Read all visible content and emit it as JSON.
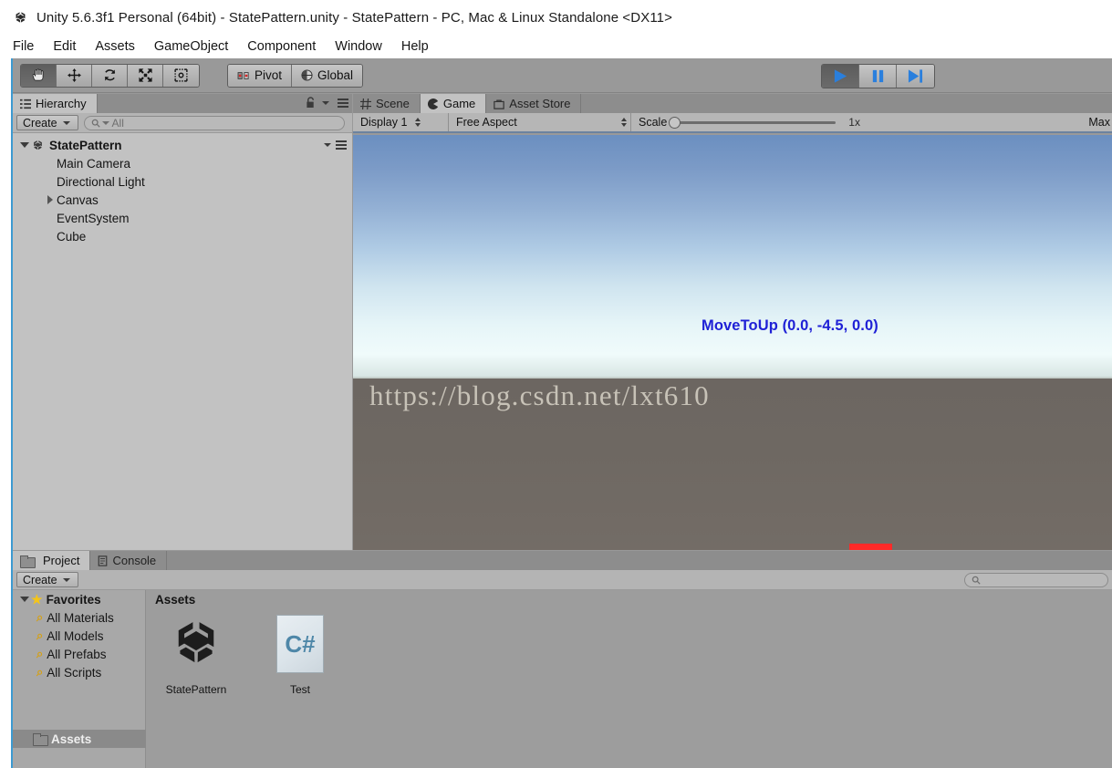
{
  "window": {
    "title": "Unity 5.6.3f1 Personal (64bit) - StatePattern.unity - StatePattern - PC, Mac & Linux Standalone <DX11>",
    "logo_icon": "unity-logo-icon"
  },
  "menubar": {
    "items": [
      "File",
      "Edit",
      "Assets",
      "GameObject",
      "Component",
      "Window",
      "Help"
    ]
  },
  "toolbar": {
    "tools": [
      {
        "name": "hand-tool",
        "icon": "hand-icon",
        "active": true
      },
      {
        "name": "move-tool",
        "icon": "move-arrows-icon",
        "active": false
      },
      {
        "name": "rotate-tool",
        "icon": "rotate-icon",
        "active": false
      },
      {
        "name": "scale-tool",
        "icon": "scale-icon",
        "active": false
      },
      {
        "name": "rect-tool",
        "icon": "rect-transform-icon",
        "active": false
      }
    ],
    "pivot_label": "Pivot",
    "pivot_icon": "pivot-icon",
    "global_label": "Global",
    "global_icon": "globe-icon",
    "play_controls": [
      {
        "name": "play-button",
        "icon": "play-icon",
        "active": true
      },
      {
        "name": "pause-button",
        "icon": "pause-icon",
        "active": false
      },
      {
        "name": "step-button",
        "icon": "step-forward-icon",
        "active": false
      }
    ],
    "accent_blue": "#2a7fdd"
  },
  "hierarchy": {
    "tab_label": "Hierarchy",
    "tab_icon": "hierarchy-icon",
    "lock_icon": "lock-icon",
    "menu_icon": "panel-menu-icon",
    "create_label": "Create",
    "search_placeholder": "All",
    "search_icon": "search-icon",
    "tree": [
      {
        "label": "StatePattern",
        "depth": 0,
        "expanded": true,
        "icon": "unity-scene-icon",
        "bold": true
      },
      {
        "label": "Main Camera",
        "depth": 1,
        "expanded": null,
        "icon": "",
        "bold": false
      },
      {
        "label": "Directional Light",
        "depth": 1,
        "expanded": null,
        "icon": "",
        "bold": false
      },
      {
        "label": "Canvas",
        "depth": 1,
        "expanded": false,
        "icon": "",
        "bold": false
      },
      {
        "label": "EventSystem",
        "depth": 1,
        "expanded": null,
        "icon": "",
        "bold": false
      },
      {
        "label": "Cube",
        "depth": 1,
        "expanded": null,
        "icon": "",
        "bold": false
      }
    ]
  },
  "center_tabs": [
    {
      "label": "Scene",
      "icon": "scene-grid-icon",
      "active": false
    },
    {
      "label": "Game",
      "icon": "game-pacman-icon",
      "active": true
    },
    {
      "label": "Asset Store",
      "icon": "asset-store-icon",
      "active": false
    }
  ],
  "game_toolbar": {
    "display_label": "Display 1",
    "aspect_label": "Free Aspect",
    "scale_label": "Scale",
    "scale_value": "1x",
    "max_label": "Max"
  },
  "game_view": {
    "state_text": "MoveToUp (0.0, -4.5, 0.0)",
    "state_text_color": "#1f21d6",
    "watermark": "https://blog.csdn.net/lxt610",
    "cube_color": "#ff2a28",
    "sky_top_color": "#6b8fc0",
    "ground_color": "#6c6661"
  },
  "project": {
    "tabs": [
      {
        "label": "Project",
        "icon": "folder-icon",
        "active": true
      },
      {
        "label": "Console",
        "icon": "console-icon",
        "active": false
      }
    ],
    "create_label": "Create",
    "search_icon": "search-icon",
    "favorites": {
      "label": "Favorites",
      "icon": "star-icon",
      "items": [
        "All Materials",
        "All Models",
        "All Prefabs",
        "All Scripts"
      ],
      "item_icon": "search-icon",
      "assets_folder": "Assets",
      "assets_folder_icon": "folder-icon"
    },
    "assets_header": "Assets",
    "assets": [
      {
        "name": "StatePattern",
        "icon": "unity-scene-icon"
      },
      {
        "name": "Test",
        "icon": "csharp-script-icon",
        "glyph": "C#"
      }
    ]
  }
}
